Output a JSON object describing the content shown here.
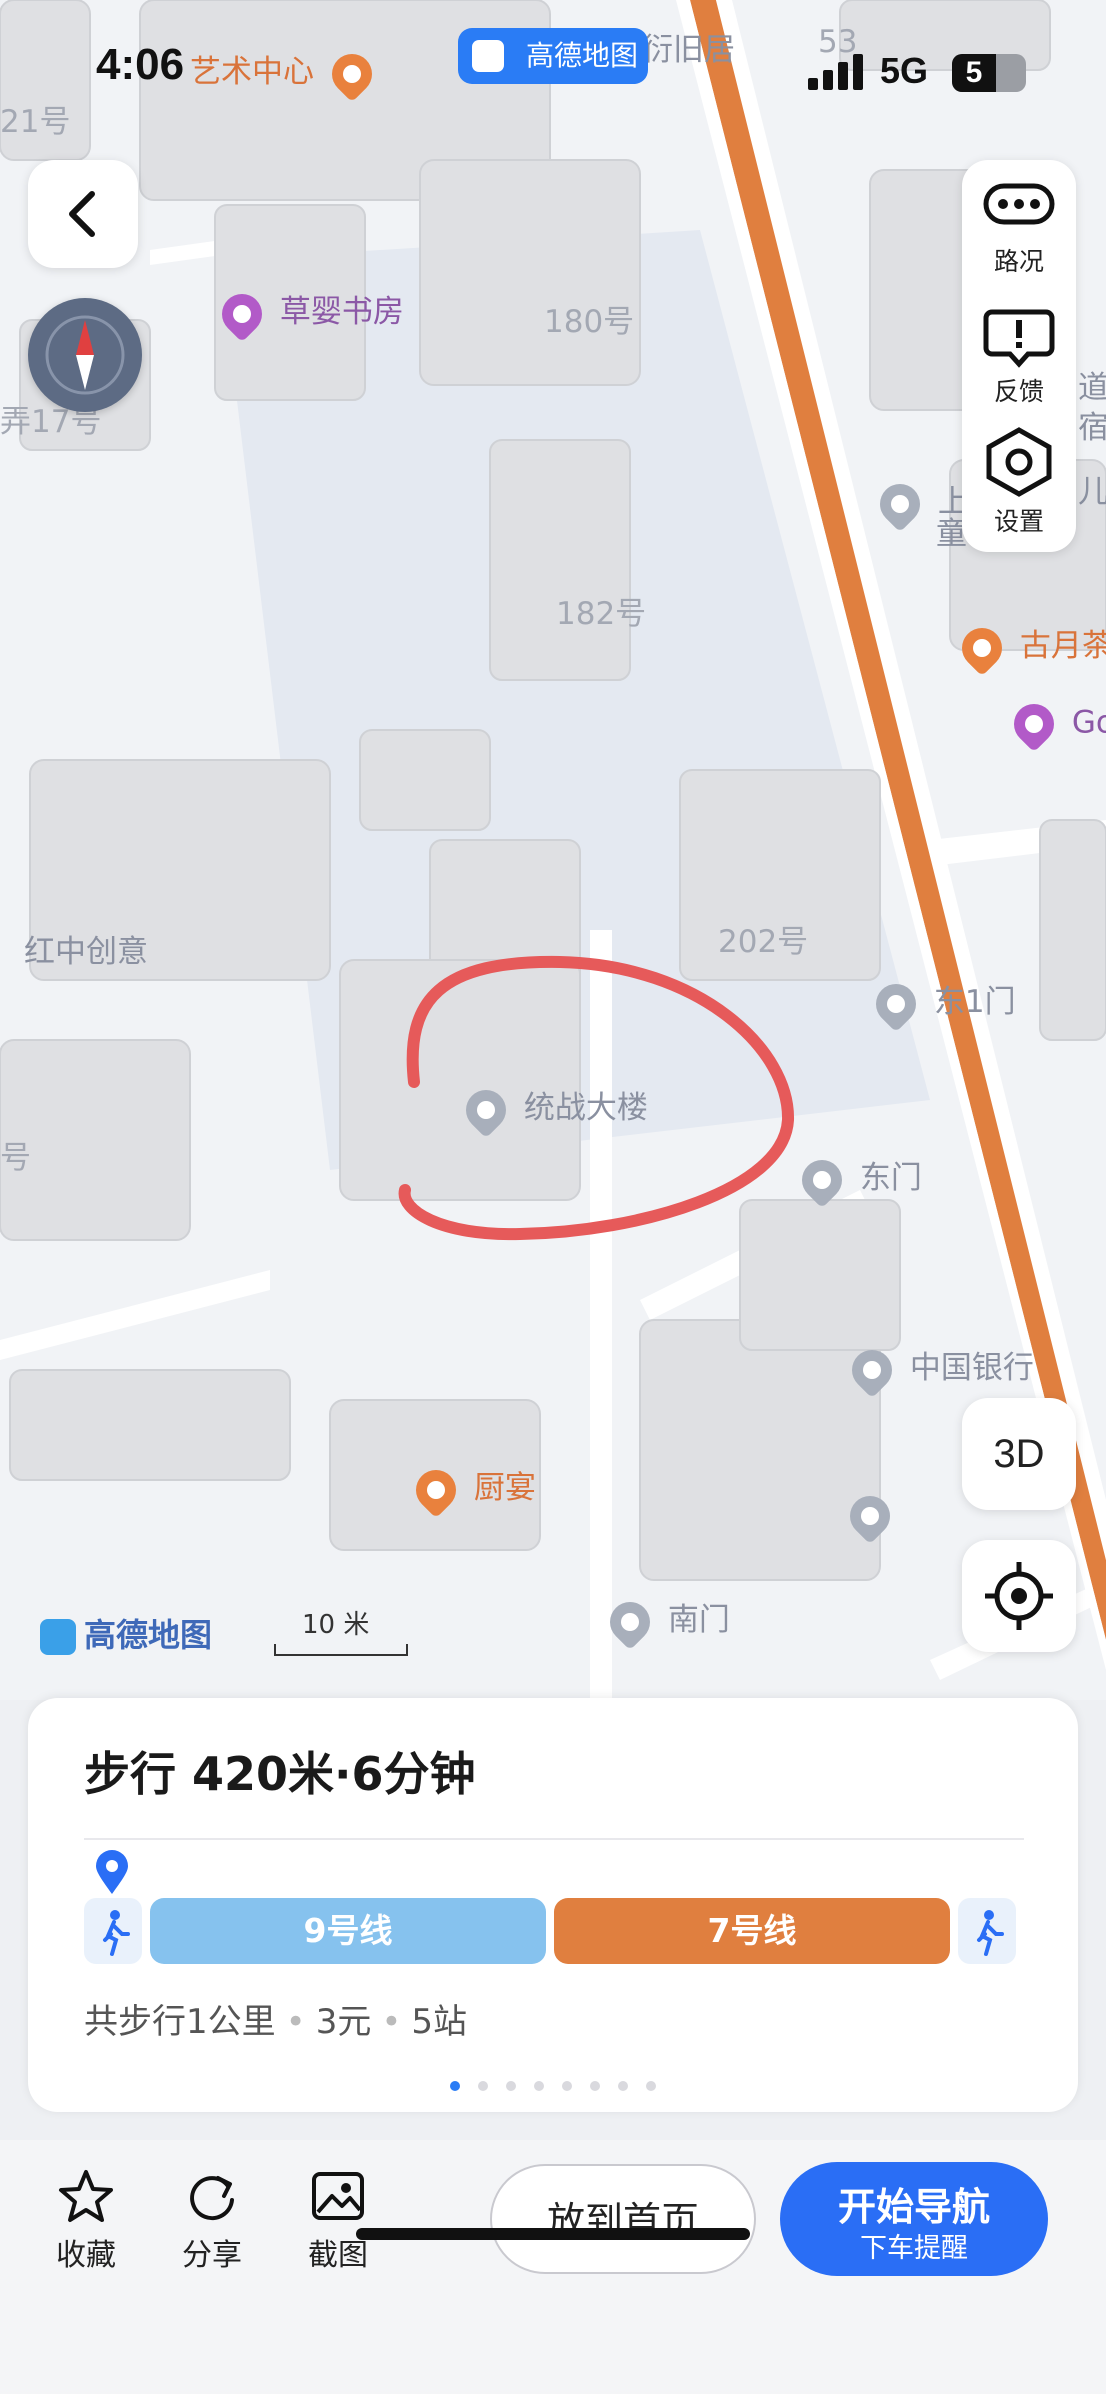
{
  "status_bar": {
    "time": "4:06",
    "network": "5G",
    "battery": "5"
  },
  "app_badge": {
    "label": "高德地图"
  },
  "map": {
    "pois": {
      "art_center": "艺术中心",
      "former_residence": "衍旧居",
      "bookstore": "草婴书房",
      "building_180": "180号",
      "building_182": "182号",
      "building_202": "202号",
      "lane_17": "弄17号",
      "num_21": "21号",
      "hongzhong": "红中创意",
      "tongzhan": "统战大楼",
      "east_gate_1": "东1门",
      "east_gate": "东门",
      "bank_of_china": "中国银行",
      "chuyan": "厨宴",
      "south_gate": "南门",
      "guyue_tea": "古月茶",
      "go": "Go",
      "side_dao": "道",
      "side_su": "宿",
      "side_er": "儿",
      "side_shang": "上",
      "side_tong": "童",
      "num_hao": "号",
      "num_53": "53"
    },
    "scale_label": "10 米",
    "watermark": "高德地图"
  },
  "controls": {
    "traffic": "路况",
    "feedback": "反馈",
    "settings": "设置",
    "view_3d": "3D"
  },
  "route": {
    "title": "步行  420米·6分钟",
    "segments": [
      {
        "label": "9号线",
        "color": "#86c2ee"
      },
      {
        "label": "7号线",
        "color": "#e07f3f"
      }
    ],
    "summary": {
      "walk": "共步行1公里",
      "fare": "3元",
      "stops": "5站"
    },
    "page_count": 8,
    "active_page": 1
  },
  "bottom_bar": {
    "favorite": "收藏",
    "share": "分享",
    "screenshot": "截图",
    "add_home": "放到首页",
    "start_nav": "开始导航",
    "alight_reminder": "下车提醒"
  },
  "colors": {
    "accent": "#2a6ef5",
    "route_orange": "#e07f3f",
    "annotation_red": "#e65a5a"
  }
}
